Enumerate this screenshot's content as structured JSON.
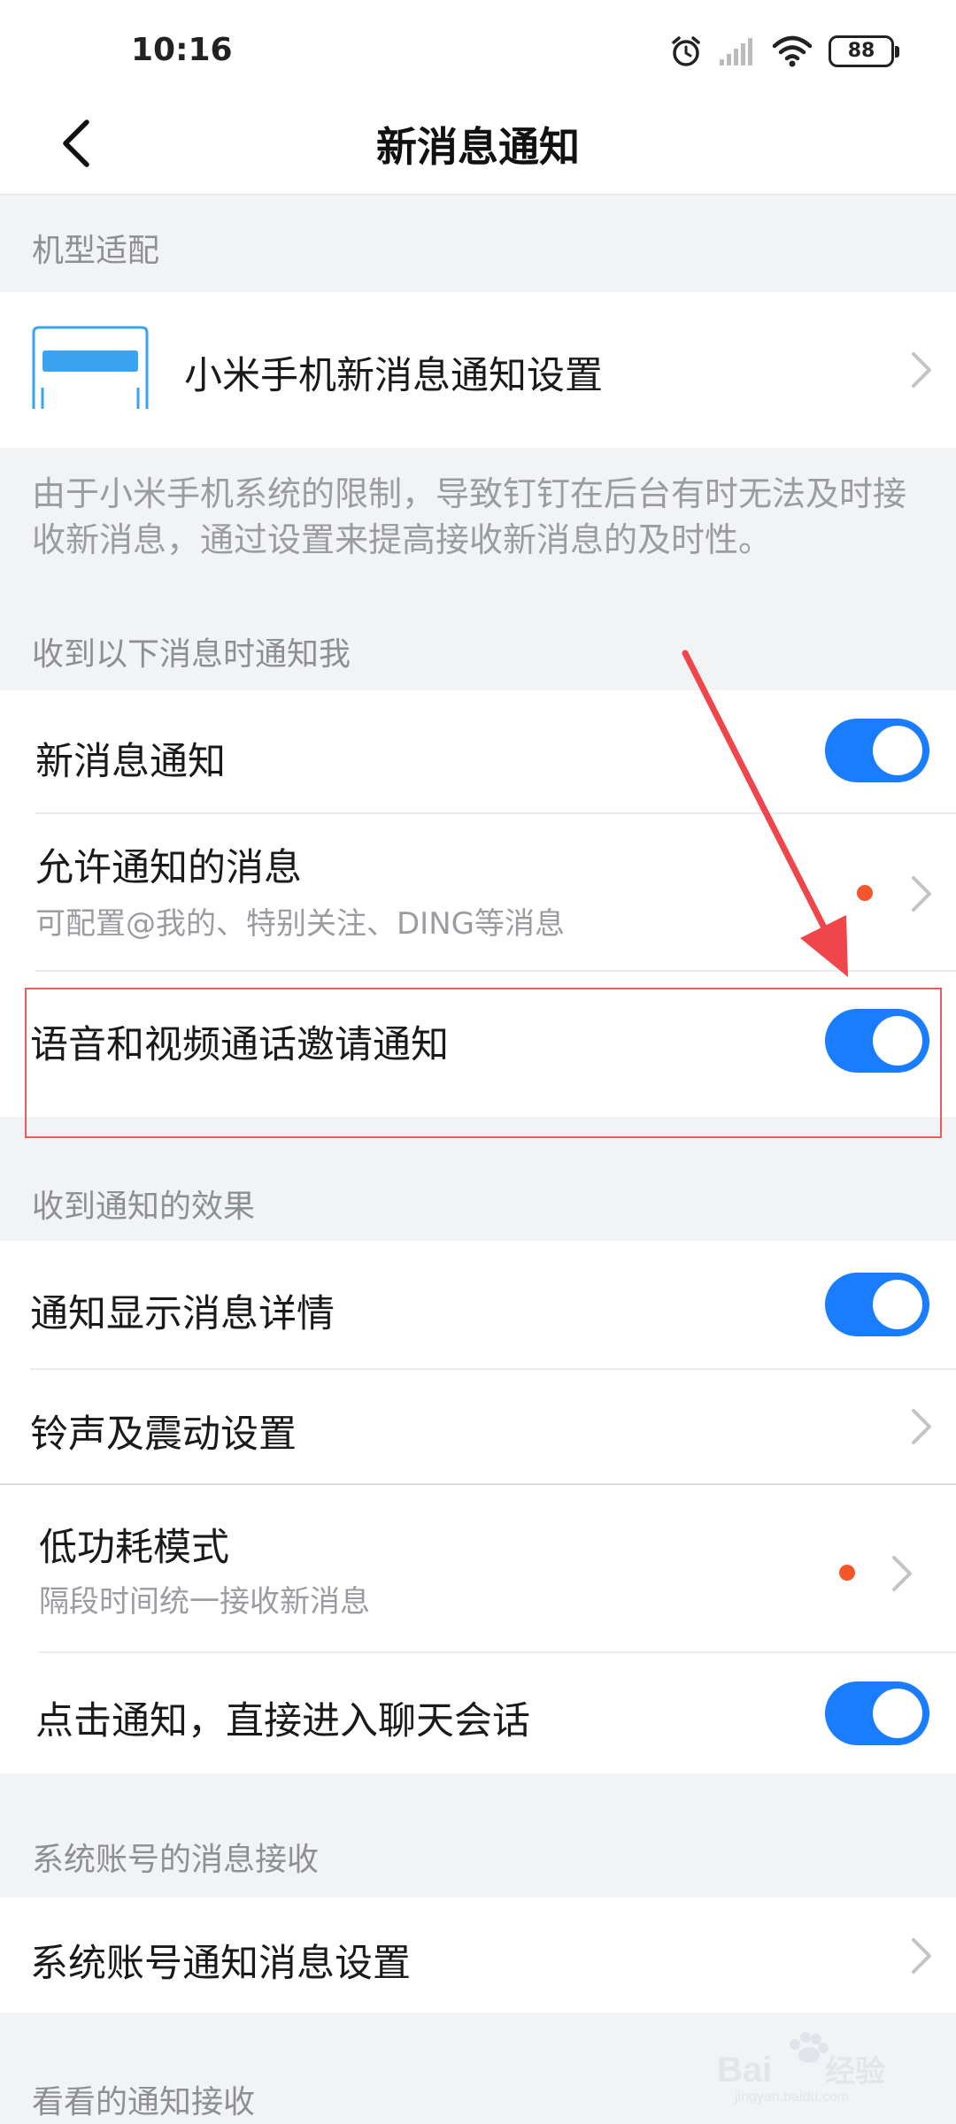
{
  "status_bar": {
    "time": "10:16",
    "battery": "88",
    "icons": [
      "alarm-icon",
      "signal-icon",
      "wifi-icon",
      "battery-icon"
    ]
  },
  "nav": {
    "back_icon": "chevron-left-icon",
    "title": "新消息通知"
  },
  "sections": {
    "model_adapt": {
      "label": "机型适配",
      "item_title": "小米手机新消息通知设置",
      "info": "由于小米手机系统的限制，导致钉钉在后台有时无法及时接收新消息，通过设置来提高接收新消息的及时性。"
    },
    "notify_me": {
      "label": "收到以下消息时通知我",
      "items": [
        {
          "title": "新消息通知",
          "toggle": true
        },
        {
          "title": "允许通知的消息",
          "subtitle": "可配置@我的、特别关注、DING等消息",
          "badge_dot": true
        },
        {
          "title": "语音和视频通话邀请通知",
          "toggle": true
        }
      ]
    },
    "effects": {
      "label": "收到通知的效果",
      "items": [
        {
          "title": "通知显示消息详情",
          "toggle": true
        },
        {
          "title": "铃声及震动设置"
        },
        {
          "title": "低功耗模式",
          "subtitle": "隔段时间统一接收新消息",
          "badge_dot": true
        },
        {
          "title": "点击通知，直接进入聊天会话",
          "toggle": true
        }
      ]
    },
    "system_accounts": {
      "label": "系统账号的消息接收",
      "items": [
        {
          "title": "系统账号通知消息设置"
        }
      ]
    },
    "watch": {
      "label": "看看的通知接收"
    }
  },
  "colors": {
    "accent": "#1a7dff",
    "badge": "#f2562a",
    "annotation": "#f0454a"
  },
  "watermark": {
    "text": "Baidu经验",
    "url": "jingyan.baidu.com"
  }
}
